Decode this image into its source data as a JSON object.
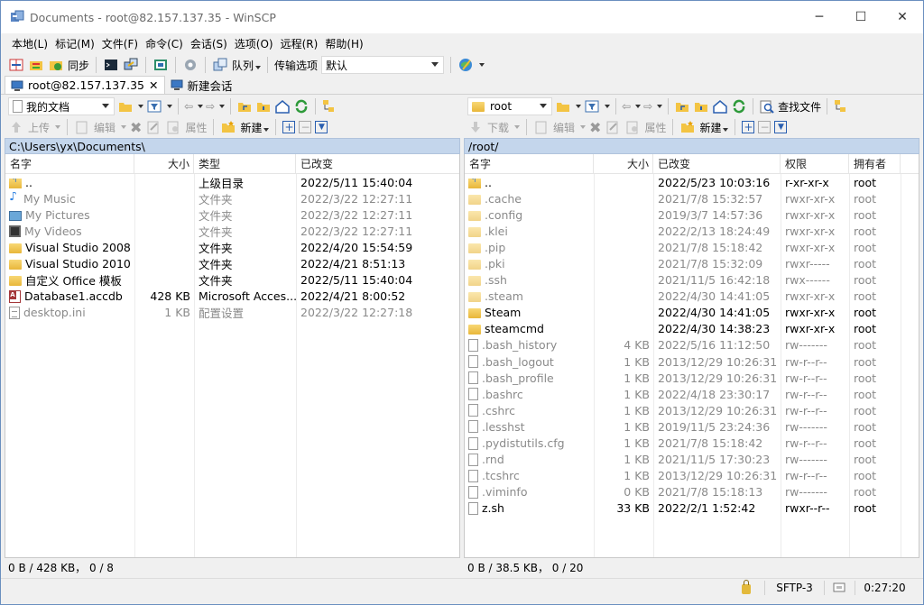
{
  "window": {
    "title": "Documents - root@82.157.137.35 - WinSCP",
    "controls": {
      "minimize": "─",
      "maximize": "☐",
      "close": "✕"
    }
  },
  "menu": [
    "本地(L)",
    "标记(M)",
    "文件(F)",
    "命令(C)",
    "会话(S)",
    "选项(O)",
    "远程(R)",
    "帮助(H)"
  ],
  "toolbar": {
    "sync_label": "同步",
    "queue_label": "队列",
    "transfer_options_label": "传输选项",
    "transfer_preset": "默认"
  },
  "tabs": {
    "session": "root@82.157.137.35",
    "new_session": "新建会话"
  },
  "left_panel": {
    "location": "我的文档",
    "upload_label": "上传",
    "edit_label": "编辑",
    "properties_label": "属性",
    "new_label": "新建",
    "path": "C:\\Users\\yx\\Documents\\",
    "columns": [
      "名字",
      "大小",
      "类型",
      "已改变"
    ],
    "rows": [
      {
        "icon": "up",
        "name": "..",
        "size": "",
        "type": "上级目录",
        "changed": "2022/5/11  15:40:04",
        "dim": false
      },
      {
        "icon": "music",
        "name": "My Music",
        "size": "",
        "type": "文件夹",
        "changed": "2022/3/22  12:27:11",
        "dim": true
      },
      {
        "icon": "pics",
        "name": "My Pictures",
        "size": "",
        "type": "文件夹",
        "changed": "2022/3/22  12:27:11",
        "dim": true
      },
      {
        "icon": "video",
        "name": "My Videos",
        "size": "",
        "type": "文件夹",
        "changed": "2022/3/22  12:27:11",
        "dim": true
      },
      {
        "icon": "folder",
        "name": "Visual Studio 2008",
        "size": "",
        "type": "文件夹",
        "changed": "2022/4/20  15:54:59",
        "dim": false
      },
      {
        "icon": "folder",
        "name": "Visual Studio 2010",
        "size": "",
        "type": "文件夹",
        "changed": "2022/4/21  8:51:13",
        "dim": false
      },
      {
        "icon": "folder",
        "name": "自定义 Office 模板",
        "size": "",
        "type": "文件夹",
        "changed": "2022/5/11  15:40:04",
        "dim": false
      },
      {
        "icon": "access",
        "name": "Database1.accdb",
        "size": "428 KB",
        "type": "Microsoft Acces...",
        "changed": "2022/4/21  8:00:52",
        "dim": false
      },
      {
        "icon": "ini",
        "name": "desktop.ini",
        "size": "1 KB",
        "type": "配置设置",
        "changed": "2022/3/22  12:27:18",
        "dim": true
      }
    ],
    "status": "0 B / 428 KB，  0 / 8"
  },
  "right_panel": {
    "location": "root",
    "find_files_label": "查找文件",
    "download_label": "下载",
    "edit_label": "编辑",
    "properties_label": "属性",
    "new_label": "新建",
    "path": "/root/",
    "columns": [
      "名字",
      "大小",
      "已改变",
      "权限",
      "拥有者"
    ],
    "rows": [
      {
        "icon": "up",
        "name": "..",
        "size": "",
        "changed": "2022/5/23 10:03:16",
        "rights": "r-xr-xr-x",
        "owner": "root",
        "dim": false
      },
      {
        "icon": "folder-hidden",
        "name": ".cache",
        "size": "",
        "changed": "2021/7/8 15:32:57",
        "rights": "rwxr-xr-x",
        "owner": "root",
        "dim": true
      },
      {
        "icon": "folder-hidden",
        "name": ".config",
        "size": "",
        "changed": "2019/3/7 14:57:36",
        "rights": "rwxr-xr-x",
        "owner": "root",
        "dim": true
      },
      {
        "icon": "folder-hidden",
        "name": ".klei",
        "size": "",
        "changed": "2022/2/13 18:24:49",
        "rights": "rwxr-xr-x",
        "owner": "root",
        "dim": true
      },
      {
        "icon": "folder-hidden",
        "name": ".pip",
        "size": "",
        "changed": "2021/7/8 15:18:42",
        "rights": "rwxr-xr-x",
        "owner": "root",
        "dim": true
      },
      {
        "icon": "folder-hidden",
        "name": ".pki",
        "size": "",
        "changed": "2021/7/8 15:32:09",
        "rights": "rwxr-----",
        "owner": "root",
        "dim": true
      },
      {
        "icon": "folder-hidden",
        "name": ".ssh",
        "size": "",
        "changed": "2021/11/5 16:42:18",
        "rights": "rwx------",
        "owner": "root",
        "dim": true
      },
      {
        "icon": "folder-hidden",
        "name": ".steam",
        "size": "",
        "changed": "2022/4/30 14:41:05",
        "rights": "rwxr-xr-x",
        "owner": "root",
        "dim": true
      },
      {
        "icon": "folder",
        "name": "Steam",
        "size": "",
        "changed": "2022/4/30 14:41:05",
        "rights": "rwxr-xr-x",
        "owner": "root",
        "dim": false
      },
      {
        "icon": "folder",
        "name": "steamcmd",
        "size": "",
        "changed": "2022/4/30 14:38:23",
        "rights": "rwxr-xr-x",
        "owner": "root",
        "dim": false
      },
      {
        "icon": "file",
        "name": ".bash_history",
        "size": "4 KB",
        "changed": "2022/5/16 11:12:50",
        "rights": "rw-------",
        "owner": "root",
        "dim": true
      },
      {
        "icon": "file",
        "name": ".bash_logout",
        "size": "1 KB",
        "changed": "2013/12/29 10:26:31",
        "rights": "rw-r--r--",
        "owner": "root",
        "dim": true
      },
      {
        "icon": "file",
        "name": ".bash_profile",
        "size": "1 KB",
        "changed": "2013/12/29 10:26:31",
        "rights": "rw-r--r--",
        "owner": "root",
        "dim": true
      },
      {
        "icon": "file",
        "name": ".bashrc",
        "size": "1 KB",
        "changed": "2022/4/18 23:30:17",
        "rights": "rw-r--r--",
        "owner": "root",
        "dim": true
      },
      {
        "icon": "file",
        "name": ".cshrc",
        "size": "1 KB",
        "changed": "2013/12/29 10:26:31",
        "rights": "rw-r--r--",
        "owner": "root",
        "dim": true
      },
      {
        "icon": "file",
        "name": ".lesshst",
        "size": "1 KB",
        "changed": "2019/11/5 23:24:36",
        "rights": "rw-------",
        "owner": "root",
        "dim": true
      },
      {
        "icon": "file",
        "name": ".pydistutils.cfg",
        "size": "1 KB",
        "changed": "2021/7/8 15:18:42",
        "rights": "rw-r--r--",
        "owner": "root",
        "dim": true
      },
      {
        "icon": "file",
        "name": ".rnd",
        "size": "1 KB",
        "changed": "2021/11/5 17:30:23",
        "rights": "rw-------",
        "owner": "root",
        "dim": true
      },
      {
        "icon": "file",
        "name": ".tcshrc",
        "size": "1 KB",
        "changed": "2013/12/29 10:26:31",
        "rights": "rw-r--r--",
        "owner": "root",
        "dim": true
      },
      {
        "icon": "file",
        "name": ".viminfo",
        "size": "0 KB",
        "changed": "2021/7/8 15:18:13",
        "rights": "rw-------",
        "owner": "root",
        "dim": true
      },
      {
        "icon": "file",
        "name": "z.sh",
        "size": "33 KB",
        "changed": "2022/2/1 1:52:42",
        "rights": "rwxr--r--",
        "owner": "root",
        "dim": false
      }
    ],
    "status": "0 B / 38.5 KB，  0 / 20"
  },
  "footer": {
    "protocol": "SFTP-3",
    "elapsed": "0:27:20"
  },
  "colors": {
    "path_bar": "#c4d6ec",
    "desktop": "#1f6fc9",
    "dim_text": "#8a8a8a"
  }
}
